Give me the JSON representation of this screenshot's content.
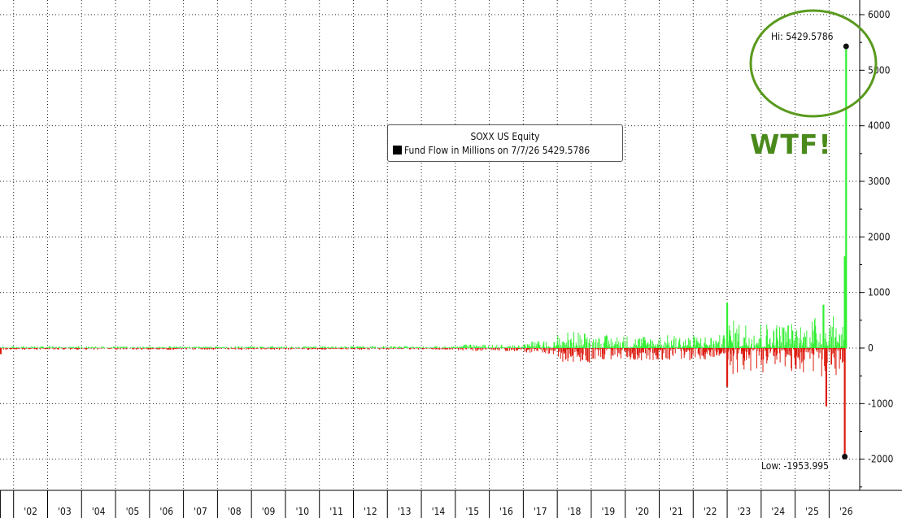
{
  "legend": {
    "title": "SOXX US Equity",
    "series_label": "Fund Flow in Millions on 7/7/26 5429.5786"
  },
  "annotations": {
    "hi_label": "Hi: 5429.5786",
    "low_label": "Low: -1953.995",
    "wtf_label": "WTF!"
  },
  "colors": {
    "positive": "#33ee33",
    "negative": "#dd1a0e",
    "circle": "#5a9a1e",
    "wtf": "#4a8a1c",
    "grid": "#222222"
  },
  "chart_data": {
    "type": "bar",
    "title": "SOXX US Equity",
    "series": [
      {
        "name": "Fund Flow in Millions on 7/7/26 5429.5786",
        "last_value": 5429.5786
      }
    ],
    "hi": 5429.5786,
    "low": -1953.995,
    "ylim": [
      -2500,
      6000
    ],
    "y_ticks": [
      6000,
      5000,
      4000,
      3000,
      2000,
      1000,
      0,
      -1000,
      -2000
    ],
    "x_tick_labels": [
      "'02",
      "'03",
      "'04",
      "'05",
      "'06",
      "'07",
      "'08",
      "'09",
      "'10",
      "'11",
      "'12",
      "'13",
      "'14",
      "'15",
      "'16",
      "'17",
      "'18",
      "'19",
      "'20",
      "'21",
      "'22",
      "'23",
      "'24",
      "'25",
      "'26"
    ],
    "xlim_years": [
      2001.6,
      2026.9
    ],
    "notable_points": [
      {
        "x": "2023-01",
        "value": 820
      },
      {
        "x": "2023-01",
        "value": -700
      },
      {
        "x": "2025-11",
        "value": 780
      },
      {
        "x": "2025-12",
        "value": -1050
      },
      {
        "x": "2026-06",
        "value": 1650
      },
      {
        "x": "2026-06",
        "value": -1953.995
      },
      {
        "x": "2026-07",
        "value": 5429.5786
      }
    ],
    "grid": true,
    "legend_position": "center-top",
    "y_axis_position": "right"
  }
}
